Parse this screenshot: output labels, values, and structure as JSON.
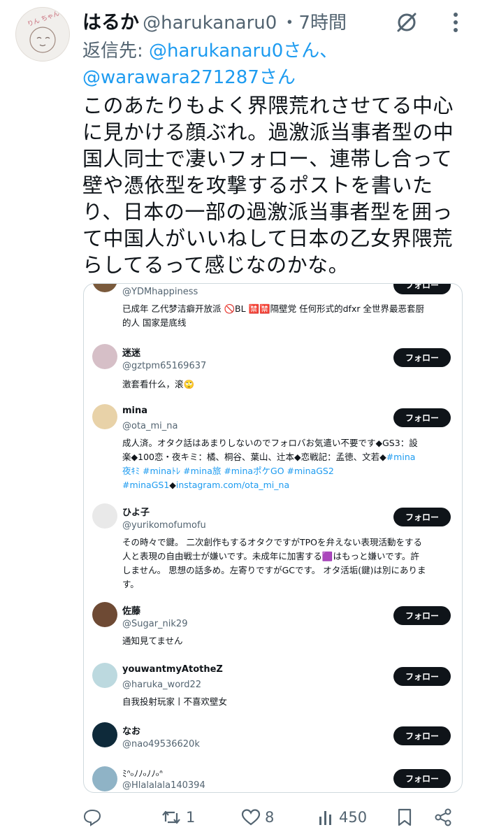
{
  "tweet": {
    "display_name": "はるか",
    "handle": "@harukanaru0",
    "time": "・7時間",
    "reply_label": "返信先: ",
    "reply_handle_1": "@harukanaru0さん、",
    "reply_handle_2": "@warawara271287さん",
    "text": "このあたりもよく界隈荒れさせてる中心に見かける顔ぶれ。過激派当事者型の中国人同士で凄いフォロー、連帯し合って壁や憑依型を攻撃するポストを書いたり、日本の一部の過激派当事者型を囲って中国人がいいねして日本の乙女界隈荒らしてるって感じなのかな。"
  },
  "follow_list": {
    "follow_label": "フォロー",
    "items": [
      {
        "name": "",
        "handle": "@YDMhappiness",
        "bio_1": "已成年 乙代梦洁癖开放派 🚫BL 🈲🈲隔壁党 任何形式的dfxr 全世界最恶套厨",
        "bio_2": "的人 国家是底线"
      },
      {
        "name": "迷迷",
        "handle": "@gztpm65169637",
        "bio": "激套看什么，滚🙄"
      },
      {
        "name": "mina",
        "handle": "@ota_mi_na",
        "bio_1": "成人済。オタク話はあまりしないのでフォロバお気遣い不要です◆GS3：設",
        "bio_2a": "楽◆100恋・夜キミ：橘、桐谷、葉山、辻本◆恋戦記：孟徳、文若◆",
        "bio_2b": "#mina",
        "bio_3": "夜ｷﾐ #minaﾄﾚ #mina旅 #minaポケGO #minaGS2",
        "bio_4a": "#minaGS1",
        "bio_4b": "◆",
        "bio_4c": "instagram.com/ota_mi_na"
      },
      {
        "name": "ひよ子",
        "handle": "@yurikomofumofu",
        "bio_1": "その時々で鍵。 二次創作もするオタクですがTPOを弁えない表現活動をする",
        "bio_2": "人と表現の自由戦士が嫌いです。未成年に加害する🟪はもっと嫌いです。許",
        "bio_3": "しません。 思想の話多め。左寄りですがGCです。 オタ活垢(鍵)は別にありま",
        "bio_4": "す。"
      },
      {
        "name": "佐藤",
        "handle": "@Sugar_nik29",
        "bio": "通知見てません"
      },
      {
        "name": "youwantmyAtotheZ",
        "handle": "@haruka_word22",
        "bio": "自我投射玩家丨不喜欢壁女"
      },
      {
        "name": "なお",
        "handle": "@nao49536620k",
        "bio": ""
      },
      {
        "name": "ﾐᐢ৹ﾉﾉ৹ﾉﾉ৹ᐢ",
        "handle": "@Hlalalala140394",
        "bio": ""
      }
    ]
  },
  "actions": {
    "reply_count": "",
    "repost_count": "1",
    "like_count": "8",
    "view_count": "450"
  },
  "icons": [
    "grok-icon",
    "more-icon",
    "reply-icon",
    "repost-icon",
    "like-icon",
    "views-icon",
    "bookmark-icon",
    "share-icon"
  ],
  "colors": {
    "link": "#1d9bf0",
    "text": "#0f1419",
    "muted": "#536471",
    "button": "#0f1419"
  }
}
